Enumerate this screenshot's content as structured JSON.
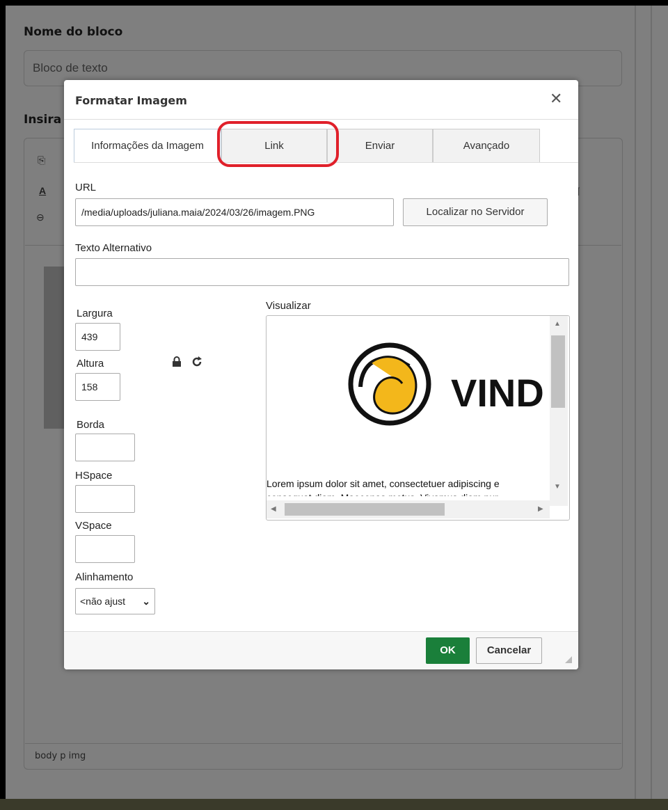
{
  "page": {
    "block_name_label": "Nome do bloco",
    "block_name_value": "Bloco de texto",
    "insert_label": "Insira",
    "status_path": "body  p  img"
  },
  "dialog": {
    "title": "Formatar Imagem",
    "tabs": [
      {
        "label": "Informações da Imagem",
        "active": true
      },
      {
        "label": "Link",
        "active": false
      },
      {
        "label": "Enviar",
        "active": false
      },
      {
        "label": "Avançado",
        "active": false
      }
    ],
    "url_label": "URL",
    "url_value": "/media/uploads/juliana.maia/2024/03/26/imagem.PNG",
    "browse_button": "Localizar no Servidor",
    "alt_label": "Texto Alternativo",
    "alt_value": "",
    "width_label": "Largura",
    "width_value": "439",
    "height_label": "Altura",
    "height_value": "158",
    "border_label": "Borda",
    "border_value": "",
    "hspace_label": "HSpace",
    "hspace_value": "",
    "vspace_label": "VSpace",
    "vspace_value": "",
    "align_label": "Alinhamento",
    "align_value": "<não ajust",
    "preview_label": "Visualizar",
    "preview_logo_text": "VIND",
    "preview_text": "Lorem ipsum dolor sit amet, consectetuer adipiscing e",
    "preview_text2": "consequat diam. Maecenas metus. Vivamus diam pur",
    "ok_button": "OK",
    "cancel_button": "Cancelar"
  },
  "colors": {
    "ok_green": "#1a7f3a",
    "highlight_red": "#e0202a",
    "logo_yellow": "#f3b71b"
  },
  "icons": [
    "close-icon",
    "lock-icon",
    "reset-size-icon",
    "chevron-down-icon"
  ]
}
